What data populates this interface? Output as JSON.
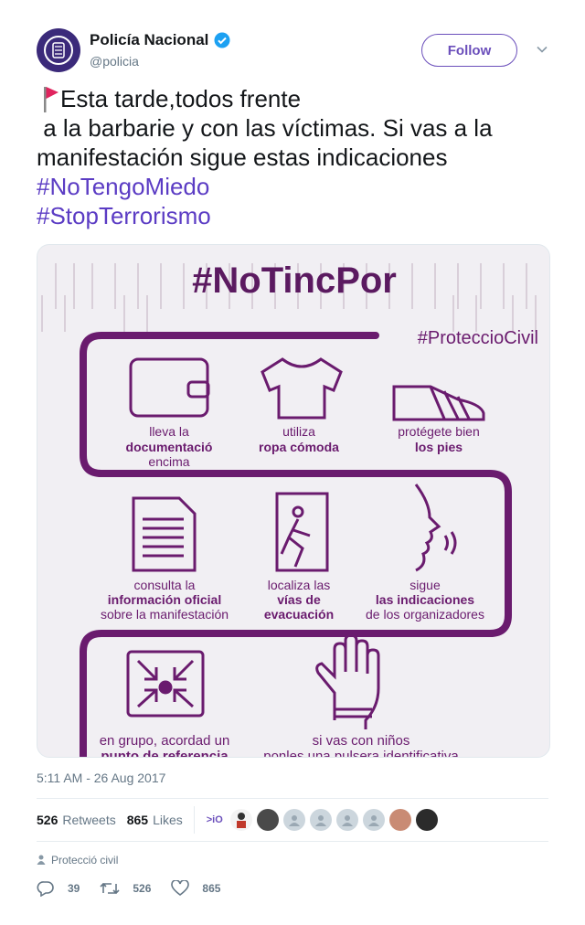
{
  "account": {
    "name": "Policía Nacional",
    "handle": "@policia",
    "follow_label": "Follow"
  },
  "tweet": {
    "line1": "Esta tarde,todos frente",
    "line2": " a la barbarie y con las víctimas. Si vas a la",
    "line3": "manifestación sigue estas indicaciones",
    "hashtag1": "#NoTengoMiedo",
    "hashtag2": "#StopTerrorismo",
    "timestamp": "5:11 AM - 26 Aug 2017",
    "place": "Protecció civil"
  },
  "media": {
    "title": "#NoTincPor",
    "tag": "#ProteccioCivil",
    "items": [
      {
        "l1": "lleva la",
        "l2": "documentació",
        "l3": "encima"
      },
      {
        "l1": "utiliza",
        "l2": "ropa cómoda",
        "l3": ""
      },
      {
        "l1": "protégete bien",
        "l2": "los pies",
        "l3": ""
      },
      {
        "l1": "consulta la",
        "l2": "información oficial",
        "l3": "sobre la manifestación"
      },
      {
        "l1": "localiza las",
        "l2": "vías de",
        "l3": "evacuación"
      },
      {
        "l1": "sigue",
        "l2": "las indicaciones",
        "l3": "de los organizadores"
      },
      {
        "l1": "en grupo, acordad un",
        "l2": "punto de referencia",
        "l3": ""
      },
      {
        "l1": "si vas con niños",
        "l2": "ponles una pulsera identificativa",
        "l3": ""
      }
    ]
  },
  "stats": {
    "retweets_count": "526",
    "retweets_label": "Retweets",
    "likes_count": "865",
    "likes_label": "Likes",
    "first_face_text": ">iO"
  },
  "actions": {
    "replies": "39",
    "retweets": "526",
    "likes": "865"
  },
  "colors": {
    "accent": "#6b4fbb",
    "infographic_purple": "#6a1b6e",
    "hashtag": "#5b3cc4",
    "muted": "#657786"
  }
}
